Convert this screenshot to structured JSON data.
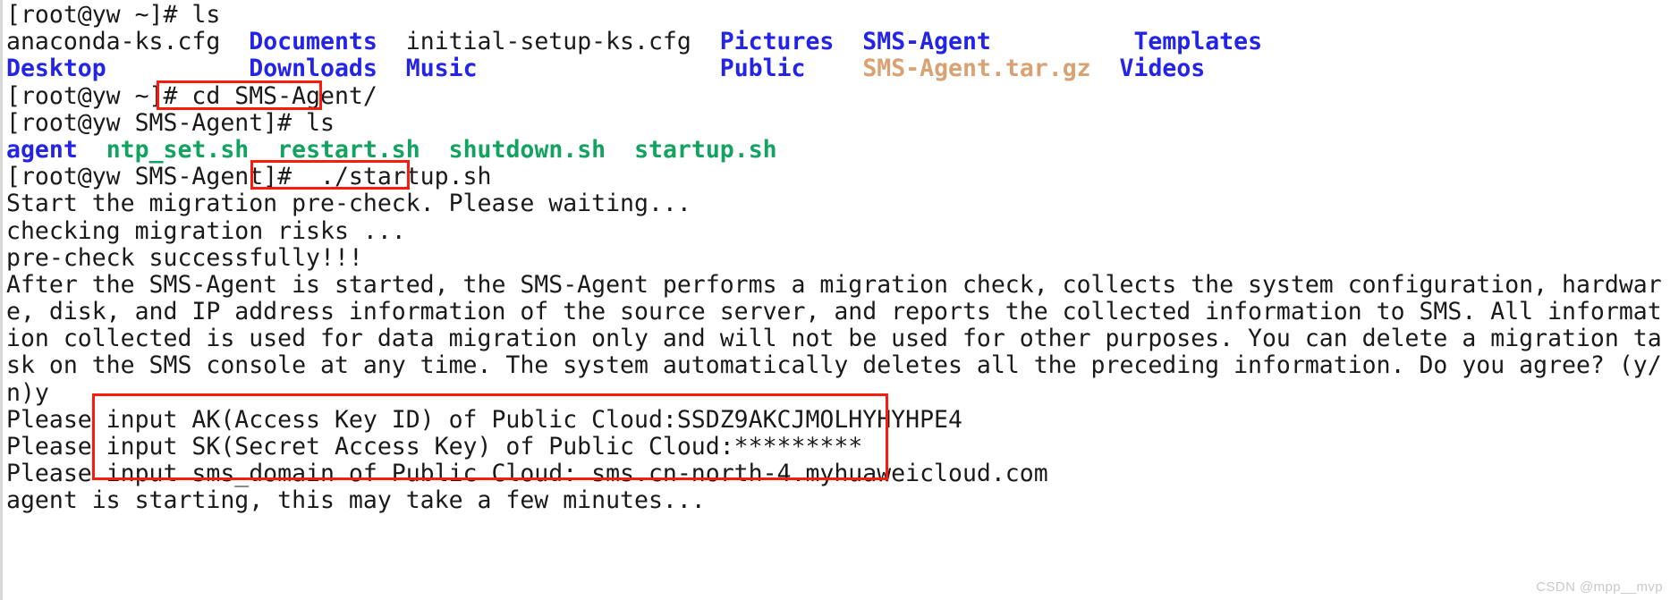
{
  "terminal": {
    "title": "SMS-Agent startup terminal session",
    "colors": {
      "background": "#ffffff",
      "foreground": "#1a1a1a",
      "directory": "#2424e8",
      "archive": "#d8a272",
      "executable": "#12a361",
      "annotation_box": "#f91c0c",
      "watermark": "#c9c9c9"
    },
    "lines": [
      {
        "id": "l1",
        "segments": [
          {
            "text": "[root@yw ~]# ls",
            "kind": "plain"
          }
        ]
      },
      {
        "id": "l2",
        "segments": [
          {
            "text": "anaconda-ks.cfg  ",
            "kind": "plain"
          },
          {
            "text": "Documents",
            "kind": "dir"
          },
          {
            "text": "  initial-setup-ks.cfg  ",
            "kind": "plain"
          },
          {
            "text": "Pictures",
            "kind": "dir"
          },
          {
            "text": "  ",
            "kind": "plain"
          },
          {
            "text": "SMS-Agent",
            "kind": "dir"
          },
          {
            "text": "          ",
            "kind": "plain"
          },
          {
            "text": "Templates",
            "kind": "dir"
          }
        ]
      },
      {
        "id": "l3",
        "segments": [
          {
            "text": "Desktop",
            "kind": "dir"
          },
          {
            "text": "          ",
            "kind": "plain"
          },
          {
            "text": "Downloads",
            "kind": "dir"
          },
          {
            "text": "  ",
            "kind": "plain"
          },
          {
            "text": "Music",
            "kind": "dir"
          },
          {
            "text": "                 ",
            "kind": "plain"
          },
          {
            "text": "Public",
            "kind": "dir"
          },
          {
            "text": "    ",
            "kind": "plain"
          },
          {
            "text": "SMS-Agent.tar.gz",
            "kind": "archive"
          },
          {
            "text": "  ",
            "kind": "plain"
          },
          {
            "text": "Videos",
            "kind": "dir"
          }
        ]
      },
      {
        "id": "l4",
        "segments": [
          {
            "text": "[root@yw ~]# cd SMS-Agent/",
            "kind": "plain"
          }
        ]
      },
      {
        "id": "l5",
        "segments": [
          {
            "text": "[root@yw SMS-Agent]# ls",
            "kind": "plain"
          }
        ]
      },
      {
        "id": "l6",
        "segments": [
          {
            "text": "agent",
            "kind": "dir"
          },
          {
            "text": "  ",
            "kind": "plain"
          },
          {
            "text": "ntp_set.sh",
            "kind": "exec"
          },
          {
            "text": "  ",
            "kind": "plain"
          },
          {
            "text": "restart.sh",
            "kind": "exec"
          },
          {
            "text": "  ",
            "kind": "plain"
          },
          {
            "text": "shutdown.sh",
            "kind": "exec"
          },
          {
            "text": "  ",
            "kind": "plain"
          },
          {
            "text": "startup.sh",
            "kind": "exec"
          }
        ]
      },
      {
        "id": "l7",
        "segments": [
          {
            "text": "[root@yw SMS-Agent]#  ./startup.sh",
            "kind": "plain"
          }
        ]
      },
      {
        "id": "l8",
        "segments": [
          {
            "text": "Start the migration pre-check. Please waiting...",
            "kind": "plain"
          }
        ]
      },
      {
        "id": "l9",
        "segments": [
          {
            "text": "checking migration risks ...",
            "kind": "plain"
          }
        ]
      },
      {
        "id": "l10",
        "segments": [
          {
            "text": "pre-check successfully!!!",
            "kind": "plain"
          }
        ]
      },
      {
        "id": "l11",
        "segments": [
          {
            "text": "After the SMS-Agent is started, the SMS-Agent performs a migration check, collects the system configuration, hardwar",
            "kind": "plain"
          }
        ]
      },
      {
        "id": "l12",
        "segments": [
          {
            "text": "e, disk, and IP address information of the source server, and reports the collected information to SMS. All informat",
            "kind": "plain"
          }
        ]
      },
      {
        "id": "l13",
        "segments": [
          {
            "text": "ion collected is used for data migration only and will not be used for other purposes. You can delete a migration ta",
            "kind": "plain"
          }
        ]
      },
      {
        "id": "l14",
        "segments": [
          {
            "text": "sk on the SMS console at any time. The system automatically deletes all the preceding information. Do you agree? (y/",
            "kind": "plain"
          }
        ]
      },
      {
        "id": "l15",
        "segments": [
          {
            "text": "n)y",
            "kind": "plain"
          }
        ]
      },
      {
        "id": "l16",
        "segments": [
          {
            "text": "Please input AK(Access Key ID) of Public Cloud:SSDZ9AKCJMOLHYHYHPE4",
            "kind": "plain"
          }
        ]
      },
      {
        "id": "l17",
        "segments": [
          {
            "text": "Please input SK(Secret Access Key) of Public Cloud:*********",
            "kind": "plain"
          }
        ]
      },
      {
        "id": "l18",
        "segments": [
          {
            "text": "Please input sms_domain of Public Cloud: sms.cn-north-4.myhuaweicloud.com",
            "kind": "plain"
          }
        ]
      },
      {
        "id": "l19",
        "segments": [
          {
            "text": "agent is starting, this may take a few minutes...",
            "kind": "plain"
          }
        ]
      }
    ],
    "annotations": [
      {
        "id": "box-cd",
        "label": "cd SMS-Agent/"
      },
      {
        "id": "box-startup",
        "label": "./startup.sh"
      },
      {
        "id": "box-inputs",
        "label": "input AK SK sms_domain"
      }
    ],
    "watermark": "CSDN @mpp__mvp"
  }
}
